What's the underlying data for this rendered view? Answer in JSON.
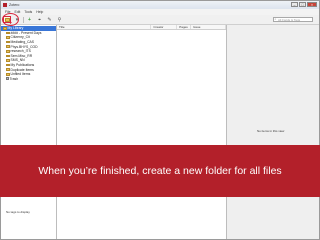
{
  "window": {
    "title": "Zotero"
  },
  "menu": [
    "File",
    "Edit",
    "Tools",
    "Help"
  ],
  "toolbar": {
    "new_collection_icon": "folder-add-icon",
    "new_item_icon": "green-plus-icon",
    "search_placeholder": "All Fields & Tags"
  },
  "collections": {
    "items": [
      {
        "label": "My Library",
        "icon": "library-icon",
        "selected": true,
        "level": 0
      },
      {
        "label": "#### - Present Days",
        "icon": "folder-icon",
        "level": 1
      },
      {
        "label": "Citizenry_Cit",
        "icon": "folder-icon",
        "level": 1
      },
      {
        "label": "Mediating_CAS",
        "icon": "folder-icon",
        "level": 1
      },
      {
        "label": "Phys.BHYS_COD",
        "icon": "folder-icon",
        "level": 1
      },
      {
        "label": "research_ITS",
        "icon": "folder-icon",
        "level": 1
      },
      {
        "label": "Sem.Misc_RR",
        "icon": "folder-icon",
        "level": 1
      },
      {
        "label": "SMS_NN",
        "icon": "folder-icon",
        "level": 1
      },
      {
        "label": "My Publications",
        "icon": "folder-icon",
        "level": 1
      },
      {
        "label": "Duplicate Items",
        "icon": "folder-icon",
        "level": 1
      },
      {
        "label": "Unfiled Items",
        "icon": "folder-icon",
        "level": 1
      },
      {
        "label": "Trash",
        "icon": "trash-icon",
        "level": 1
      }
    ]
  },
  "tag_selector": {
    "message": "No tags to display"
  },
  "items_table": {
    "columns": [
      "Title",
      "Creator",
      "Pages",
      "Issue"
    ]
  },
  "item_pane": {
    "message": "No items in this view"
  },
  "banner": {
    "text": "When you’re finished, create a new folder for all files",
    "color": "#b3202a"
  }
}
